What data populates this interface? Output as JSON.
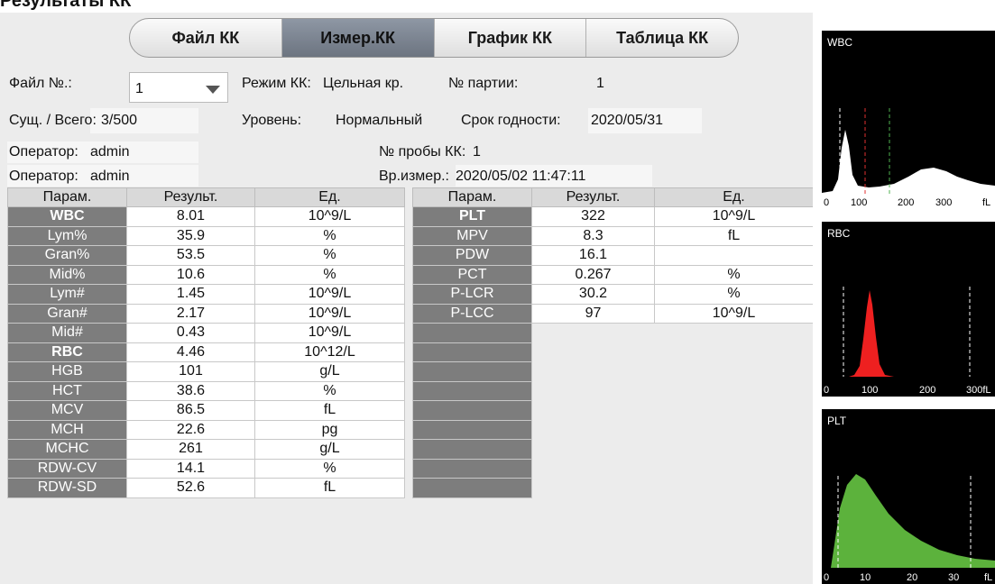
{
  "page_title": "Результаты КК",
  "tabs": [
    {
      "label": "Файл КК",
      "active": false
    },
    {
      "label": "Измер.КК",
      "active": true
    },
    {
      "label": "График КК",
      "active": false
    },
    {
      "label": "Таблица КК",
      "active": false
    }
  ],
  "info": {
    "file_label": "Файл №.:",
    "file_value": "1",
    "mode_label": "Режим КК:",
    "mode_value": "Цельная кр.",
    "lot_label": "№ партии:",
    "lot_value": "1",
    "count_label": "Сущ. / Всего:",
    "count_value": "3/500",
    "level_label": "Уровень:",
    "level_value": "Нормальный",
    "expiry_label": "Срок годности:",
    "expiry_value": "2020/05/31",
    "operator1_label": "Оператор:",
    "operator1_value": "admin",
    "sample_label": "№ пробы КК:",
    "sample_value": "1",
    "operator2_label": "Оператор:",
    "operator2_value": "admin",
    "time_label": "Вр.измер.:",
    "time_value": "2020/05/02 11:47:11"
  },
  "table_headers": {
    "param": "Парам.",
    "result": "Результ.",
    "unit": "Ед."
  },
  "left_rows": [
    {
      "param": "WBC",
      "result": "8.01",
      "unit": "10^9/L",
      "bold": true
    },
    {
      "param": "Lym%",
      "result": "35.9",
      "unit": "%"
    },
    {
      "param": "Gran%",
      "result": "53.5",
      "unit": "%"
    },
    {
      "param": "Mid%",
      "result": "10.6",
      "unit": "%"
    },
    {
      "param": "Lym#",
      "result": "1.45",
      "unit": "10^9/L"
    },
    {
      "param": "Gran#",
      "result": "2.17",
      "unit": "10^9/L"
    },
    {
      "param": "Mid#",
      "result": "0.43",
      "unit": "10^9/L"
    },
    {
      "param": "RBC",
      "result": "4.46",
      "unit": "10^12/L",
      "bold": true
    },
    {
      "param": "HGB",
      "result": "101",
      "unit": "g/L"
    },
    {
      "param": "HCT",
      "result": "38.6",
      "unit": "%"
    },
    {
      "param": "MCV",
      "result": "86.5",
      "unit": "fL"
    },
    {
      "param": "MCH",
      "result": "22.6",
      "unit": "pg"
    },
    {
      "param": "MCHC",
      "result": "261",
      "unit": "g/L"
    },
    {
      "param": "RDW-CV",
      "result": "14.1",
      "unit": "%"
    },
    {
      "param": "RDW-SD",
      "result": "52.6",
      "unit": "fL"
    }
  ],
  "right_rows": [
    {
      "param": "PLT",
      "result": "322",
      "unit": "10^9/L",
      "bold": true
    },
    {
      "param": "MPV",
      "result": "8.3",
      "unit": "fL"
    },
    {
      "param": "PDW",
      "result": "16.1",
      "unit": ""
    },
    {
      "param": "PCT",
      "result": "0.267",
      "unit": "%"
    },
    {
      "param": "P-LCR",
      "result": "30.2",
      "unit": "%"
    },
    {
      "param": "P-LCC",
      "result": "97",
      "unit": "10^9/L"
    }
  ],
  "histograms": [
    {
      "title": "WBC",
      "color": "#ffffff",
      "ticks": [
        "0",
        "100",
        "200",
        "300",
        "fL"
      ],
      "markers": [
        "#ffffff",
        "#e03030",
        "#4fb24f"
      ]
    },
    {
      "title": "RBC",
      "color": "#ee2020",
      "ticks": [
        "0",
        "100",
        "200",
        "300fL"
      ],
      "markers": [
        "#ffffff",
        "#ffffff"
      ]
    },
    {
      "title": "PLT",
      "color": "#5cb23c",
      "ticks": [
        "0",
        "10",
        "20",
        "30",
        "fL"
      ],
      "markers": [
        "#ffffff",
        "#ffffff"
      ]
    }
  ]
}
